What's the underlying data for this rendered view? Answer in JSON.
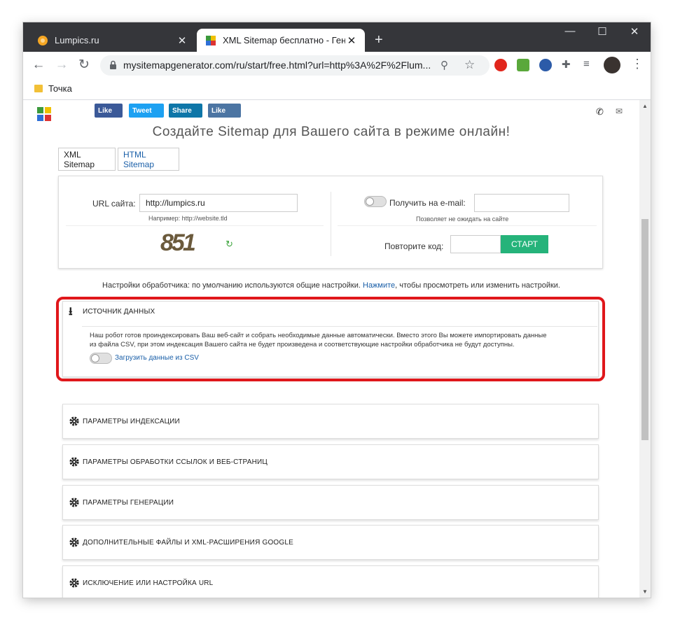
{
  "browser": {
    "tabs": [
      {
        "title": "Lumpics.ru",
        "favicon": "orange-circle-icon",
        "active": false
      },
      {
        "title": "XML Sitemap бесплатно - Генер",
        "favicon": "puzzle-icon",
        "active": true
      }
    ],
    "new_tab": "+",
    "address": "mysitemapgenerator.com/ru/start/free.html?url=http%3A%2F%2Flum...",
    "bookmark": "Точка",
    "extensions": [
      "opera-icon",
      "music-icon",
      "vpn-icon",
      "puzzle-ext-icon",
      "playlist-icon",
      "avatar"
    ]
  },
  "page": {
    "social": [
      "Like",
      "Tweet",
      "Share",
      "Like"
    ],
    "heading": "Создайте Sitemap для Вашего сайта в режиме онлайн!",
    "tabs": [
      "XML Sitemap",
      "HTML Sitemap"
    ],
    "url_label": "URL сайта:",
    "url_value": "http://lumpics.ru",
    "url_hint": "Например: http://website.tld",
    "email_label": "Получить на e-mail:",
    "email_hint": "Позволяет не ожидать на сайте",
    "captcha_text": "851",
    "repeat_label": "Повторите код:",
    "start_button": "СТАРТ",
    "settings_text_before": "Настройки обработчика: по умолчанию используются общие настройки.",
    "settings_link": "Нажмите",
    "settings_text_after": ", чтобы просмотреть или изменить настройки.",
    "data_source": {
      "title": "ИСТОЧНИК ДАННЫХ",
      "description_line1": "Наш робот готов проиндексировать Ваш веб-сайт и собрать необходимые данные автоматически. Вместо этого Вы можете импортировать данные",
      "description_line2": "из файла CSV, при этом индексация Вашего сайта не будет произведена и соответствующие настройки обработчика не будут доступны.",
      "toggle_label": "Загрузить данные из CSV"
    },
    "sections": [
      "ПАРАМЕТРЫ ИНДЕКСАЦИИ",
      "ПАРАМЕТРЫ ОБРАБОТКИ ССЫЛОК И ВЕБ-СТРАНИЦ",
      "ПАРАМЕТРЫ ГЕНЕРАЦИИ",
      "ДОПОЛНИТЕЛЬНЫЕ ФАЙЛЫ И XML-РАСШИРЕНИЯ GOOGLE",
      "ИСКЛЮЧЕНИЕ ИЛИ НАСТРОЙКА URL"
    ]
  },
  "colors": {
    "highlight": "#e0171b",
    "start": "#25b37a",
    "link": "#1a5fa8",
    "social": "#3b5998"
  }
}
